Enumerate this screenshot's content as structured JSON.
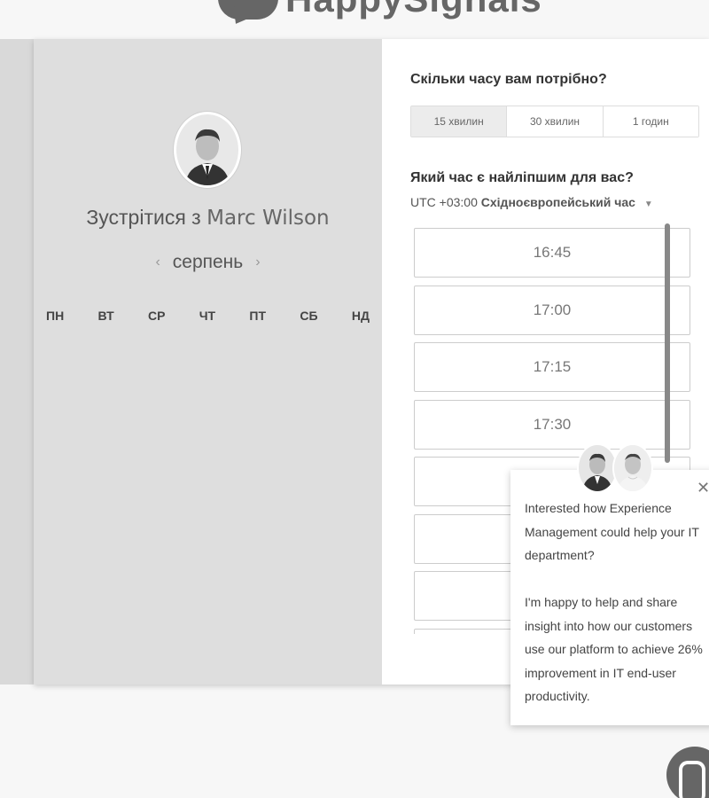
{
  "brand": {
    "logo_text": "HappySignals"
  },
  "left": {
    "meet_prefix": "Зустрітися з",
    "host_name": "Marc Wilson",
    "month": "серпень",
    "weekdays": [
      "ПН",
      "ВТ",
      "СР",
      "ЧТ",
      "ПТ",
      "СБ",
      "НД"
    ]
  },
  "right": {
    "duration_question": "Скільки часу вам потрібно?",
    "durations": [
      {
        "label": "15 хвилин",
        "active": true
      },
      {
        "label": "30 хвилин",
        "active": false
      },
      {
        "label": "1 годин",
        "active": false
      }
    ],
    "time_question": "Який час є найліпшим для вас?",
    "timezone_offset": "UTC +03:00",
    "timezone_name": "Східноєвропейський час",
    "slots": [
      "16:45",
      "17:00",
      "17:15",
      "17:30",
      "",
      "",
      "",
      ""
    ]
  },
  "chat": {
    "message_1": "Interested how Experience Management could help your IT department?",
    "message_2": "I'm happy to help and share insight into how our customers use our platform to achieve 26% improvement in IT end-user productivity."
  },
  "icons": {
    "close": "close-icon",
    "prev": "chevron-left-icon",
    "next": "chevron-right-icon",
    "caret": "caret-down-icon"
  }
}
